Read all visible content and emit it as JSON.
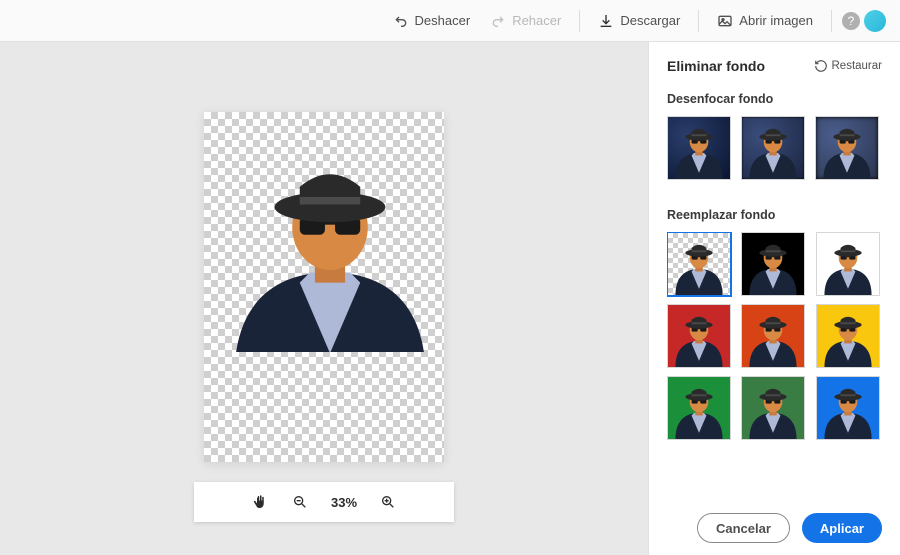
{
  "toolbar": {
    "undo": "Deshacer",
    "redo": "Rehacer",
    "download": "Descargar",
    "open_image": "Abrir imagen"
  },
  "zoom": {
    "level": "33%"
  },
  "panel": {
    "title": "Eliminar fondo",
    "restore": "Restaurar",
    "blur_label": "Desenfocar fondo",
    "replace_label": "Reemplazar fondo",
    "replace_options": [
      {
        "kind": "transparent",
        "selected": true
      },
      {
        "kind": "solid",
        "color": "#000000"
      },
      {
        "kind": "solid",
        "color": "#ffffff"
      },
      {
        "kind": "solid",
        "color": "#c62828"
      },
      {
        "kind": "solid",
        "color": "#d84315"
      },
      {
        "kind": "solid",
        "color": "#f9c80e"
      },
      {
        "kind": "solid",
        "color": "#1b8f3a"
      },
      {
        "kind": "solid",
        "color": "#3a7d44"
      },
      {
        "kind": "solid",
        "color": "#1473e6"
      }
    ],
    "cancel": "Cancelar",
    "apply": "Aplicar"
  }
}
